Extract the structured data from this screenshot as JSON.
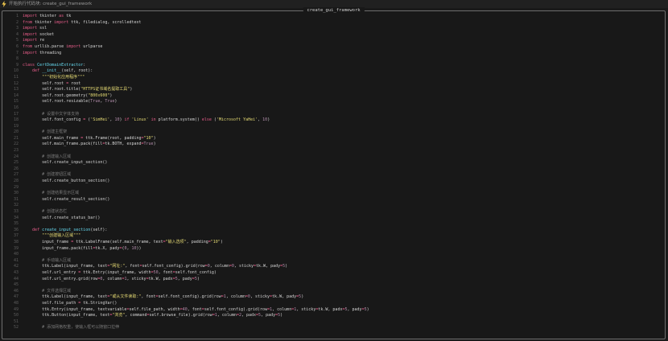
{
  "header": {
    "icon": "lightning-icon",
    "title": "开始执行代码块: create_gui_framework"
  },
  "panel": {
    "title": "create_gui_framework"
  },
  "colors": {
    "keyword": "#e85d8a",
    "string": "#e6db74",
    "comment": "#7a7a7a",
    "definition": "#66d9ef",
    "number": "#b48ead",
    "text": "#d4d4d4",
    "line_number": "#5c5c5c"
  },
  "code_lines": [
    {
      "n": "1",
      "segs": [
        [
          "k",
          "import"
        ],
        [
          "t",
          " tkinter "
        ],
        [
          "k",
          "as"
        ],
        [
          "t",
          " tk"
        ]
      ]
    },
    {
      "n": "2",
      "segs": [
        [
          "k",
          "from"
        ],
        [
          "t",
          " tkinter "
        ],
        [
          "k",
          "import"
        ],
        [
          "t",
          " ttk, filedialog, scrolledtext"
        ]
      ]
    },
    {
      "n": "3",
      "segs": [
        [
          "k",
          "import"
        ],
        [
          "t",
          " ssl"
        ]
      ]
    },
    {
      "n": "4",
      "segs": [
        [
          "k",
          "import"
        ],
        [
          "t",
          " socket"
        ]
      ]
    },
    {
      "n": "5",
      "segs": [
        [
          "k",
          "import"
        ],
        [
          "t",
          " re"
        ]
      ]
    },
    {
      "n": "6",
      "segs": [
        [
          "k",
          "from"
        ],
        [
          "t",
          " urllib.parse "
        ],
        [
          "k",
          "import"
        ],
        [
          "t",
          " urlparse"
        ]
      ]
    },
    {
      "n": "7",
      "segs": [
        [
          "k",
          "import"
        ],
        [
          "t",
          " threading"
        ]
      ]
    },
    {
      "n": "8",
      "segs": []
    },
    {
      "n": "9",
      "segs": [
        [
          "k",
          "class"
        ],
        [
          "t",
          " "
        ],
        [
          "d",
          "CertDomainExtractor"
        ],
        [
          "t",
          ":"
        ]
      ]
    },
    {
      "n": "10",
      "segs": [
        [
          "t",
          "    "
        ],
        [
          "k",
          "def"
        ],
        [
          "t",
          " "
        ],
        [
          "d",
          "__init__"
        ],
        [
          "t",
          "(self, root):"
        ]
      ]
    },
    {
      "n": "11",
      "segs": [
        [
          "t",
          "        "
        ],
        [
          "s",
          "\"\"\"初始化应用程序\"\"\""
        ]
      ]
    },
    {
      "n": "12",
      "segs": [
        [
          "t",
          "        self.root "
        ],
        [
          "k",
          "="
        ],
        [
          "t",
          " root"
        ]
      ]
    },
    {
      "n": "13",
      "segs": [
        [
          "t",
          "        self.root.title("
        ],
        [
          "s",
          "\"HTTPS证书域名提取工具\""
        ],
        [
          "t",
          ")"
        ]
      ]
    },
    {
      "n": "14",
      "segs": [
        [
          "t",
          "        self.root.geometry("
        ],
        [
          "s",
          "\"800x600\""
        ],
        [
          "t",
          ")"
        ]
      ]
    },
    {
      "n": "15",
      "segs": [
        [
          "t",
          "        self.root.resizable("
        ],
        [
          "n",
          "True"
        ],
        [
          "t",
          ", "
        ],
        [
          "n",
          "True"
        ],
        [
          "t",
          ")"
        ]
      ]
    },
    {
      "n": "16",
      "segs": []
    },
    {
      "n": "17",
      "segs": [
        [
          "t",
          "        "
        ],
        [
          "c",
          "# 设置中文字体支持"
        ]
      ]
    },
    {
      "n": "18",
      "segs": [
        [
          "t",
          "        self.font_config "
        ],
        [
          "k",
          "="
        ],
        [
          "t",
          " ("
        ],
        [
          "s",
          "'SimHei'"
        ],
        [
          "t",
          ", "
        ],
        [
          "n",
          "10"
        ],
        [
          "t",
          ") "
        ],
        [
          "k",
          "if"
        ],
        [
          "t",
          " "
        ],
        [
          "s",
          "'Linux'"
        ],
        [
          "t",
          " "
        ],
        [
          "k",
          "in"
        ],
        [
          "t",
          " platform.system() "
        ],
        [
          "k",
          "else"
        ],
        [
          "t",
          " ("
        ],
        [
          "s",
          "'Microsoft YaHei'"
        ],
        [
          "t",
          ", "
        ],
        [
          "n",
          "10"
        ],
        [
          "t",
          ")"
        ]
      ]
    },
    {
      "n": "19",
      "segs": []
    },
    {
      "n": "20",
      "segs": [
        [
          "t",
          "        "
        ],
        [
          "c",
          "# 创建主框架"
        ]
      ]
    },
    {
      "n": "21",
      "segs": [
        [
          "t",
          "        self.main_frame "
        ],
        [
          "k",
          "="
        ],
        [
          "t",
          " ttk.Frame(root, padding"
        ],
        [
          "k",
          "="
        ],
        [
          "s",
          "\"10\""
        ],
        [
          "t",
          ")"
        ]
      ]
    },
    {
      "n": "22",
      "segs": [
        [
          "t",
          "        self.main_frame.pack(fill"
        ],
        [
          "k",
          "="
        ],
        [
          "t",
          "tk.BOTH, expand"
        ],
        [
          "k",
          "="
        ],
        [
          "n",
          "True"
        ],
        [
          "t",
          ")"
        ]
      ]
    },
    {
      "n": "23",
      "segs": []
    },
    {
      "n": "24",
      "segs": [
        [
          "t",
          "        "
        ],
        [
          "c",
          "# 创建输入区域"
        ]
      ]
    },
    {
      "n": "25",
      "segs": [
        [
          "t",
          "        self.create_input_section()"
        ]
      ]
    },
    {
      "n": "26",
      "segs": []
    },
    {
      "n": "27",
      "segs": [
        [
          "t",
          "        "
        ],
        [
          "c",
          "# 创建按钮区域"
        ]
      ]
    },
    {
      "n": "28",
      "segs": [
        [
          "t",
          "        self.create_button_section()"
        ]
      ]
    },
    {
      "n": "29",
      "segs": []
    },
    {
      "n": "30",
      "segs": [
        [
          "t",
          "        "
        ],
        [
          "c",
          "# 创建结果显示区域"
        ]
      ]
    },
    {
      "n": "31",
      "segs": [
        [
          "t",
          "        self.create_result_section()"
        ]
      ]
    },
    {
      "n": "32",
      "segs": []
    },
    {
      "n": "33",
      "segs": [
        [
          "t",
          "        "
        ],
        [
          "c",
          "# 创建状态栏"
        ]
      ]
    },
    {
      "n": "34",
      "segs": [
        [
          "t",
          "        self.create_status_bar()"
        ]
      ]
    },
    {
      "n": "35",
      "segs": []
    },
    {
      "n": "36",
      "segs": [
        [
          "t",
          "    "
        ],
        [
          "k",
          "def"
        ],
        [
          "t",
          " "
        ],
        [
          "d",
          "create_input_section"
        ],
        [
          "t",
          "(self):"
        ]
      ]
    },
    {
      "n": "37",
      "segs": [
        [
          "t",
          "        "
        ],
        [
          "s",
          "\"\"\"创建输入区域\"\"\""
        ]
      ]
    },
    {
      "n": "38",
      "segs": [
        [
          "t",
          "        input_frame "
        ],
        [
          "k",
          "="
        ],
        [
          "t",
          " ttk.LabelFrame(self.main_frame, text"
        ],
        [
          "k",
          "="
        ],
        [
          "s",
          "\"输入选项\""
        ],
        [
          "t",
          ", padding"
        ],
        [
          "k",
          "="
        ],
        [
          "s",
          "\"10\""
        ],
        [
          "t",
          ")"
        ]
      ]
    },
    {
      "n": "39",
      "segs": [
        [
          "t",
          "        input_frame.pack(fill"
        ],
        [
          "k",
          "="
        ],
        [
          "t",
          "tk.X, pady"
        ],
        [
          "k",
          "="
        ],
        [
          "t",
          "("
        ],
        [
          "n",
          "0"
        ],
        [
          "t",
          ", "
        ],
        [
          "n",
          "10"
        ],
        [
          "t",
          "))"
        ]
      ]
    },
    {
      "n": "40",
      "segs": []
    },
    {
      "n": "41",
      "segs": [
        [
          "t",
          "        "
        ],
        [
          "c",
          "# 手动输入区域"
        ]
      ]
    },
    {
      "n": "42",
      "segs": [
        [
          "t",
          "        ttk.Label(input_frame, text"
        ],
        [
          "k",
          "="
        ],
        [
          "s",
          "\"网址:\""
        ],
        [
          "t",
          ", font"
        ],
        [
          "k",
          "="
        ],
        [
          "t",
          "self.font_config).grid(row"
        ],
        [
          "k",
          "="
        ],
        [
          "n",
          "0"
        ],
        [
          "t",
          ", column"
        ],
        [
          "k",
          "="
        ],
        [
          "n",
          "0"
        ],
        [
          "t",
          ", sticky"
        ],
        [
          "k",
          "="
        ],
        [
          "t",
          "tk.W, pady"
        ],
        [
          "k",
          "="
        ],
        [
          "n",
          "5"
        ],
        [
          "t",
          ")"
        ]
      ]
    },
    {
      "n": "43",
      "segs": [
        [
          "t",
          "        self.url_entry "
        ],
        [
          "k",
          "="
        ],
        [
          "t",
          " ttk.Entry(input_frame, width"
        ],
        [
          "k",
          "="
        ],
        [
          "n",
          "50"
        ],
        [
          "t",
          ", font"
        ],
        [
          "k",
          "="
        ],
        [
          "t",
          "self.font_config)"
        ]
      ]
    },
    {
      "n": "44",
      "segs": [
        [
          "t",
          "        self.url_entry.grid(row"
        ],
        [
          "k",
          "="
        ],
        [
          "n",
          "0"
        ],
        [
          "t",
          ", column"
        ],
        [
          "k",
          "="
        ],
        [
          "n",
          "1"
        ],
        [
          "t",
          ", sticky"
        ],
        [
          "k",
          "="
        ],
        [
          "t",
          "tk.W, padx"
        ],
        [
          "k",
          "="
        ],
        [
          "n",
          "5"
        ],
        [
          "t",
          ", pady"
        ],
        [
          "k",
          "="
        ],
        [
          "n",
          "5"
        ],
        [
          "t",
          ")"
        ]
      ]
    },
    {
      "n": "45",
      "segs": []
    },
    {
      "n": "46",
      "segs": [
        [
          "t",
          "        "
        ],
        [
          "c",
          "# 文件选择区域"
        ]
      ]
    },
    {
      "n": "47",
      "segs": [
        [
          "t",
          "        ttk.Label(input_frame, text"
        ],
        [
          "k",
          "="
        ],
        [
          "s",
          "\"或从文件读取:\""
        ],
        [
          "t",
          ", font"
        ],
        [
          "k",
          "="
        ],
        [
          "t",
          "self.font_config).grid(row"
        ],
        [
          "k",
          "="
        ],
        [
          "n",
          "1"
        ],
        [
          "t",
          ", column"
        ],
        [
          "k",
          "="
        ],
        [
          "n",
          "0"
        ],
        [
          "t",
          ", sticky"
        ],
        [
          "k",
          "="
        ],
        [
          "t",
          "tk.W, pady"
        ],
        [
          "k",
          "="
        ],
        [
          "n",
          "5"
        ],
        [
          "t",
          ")"
        ]
      ]
    },
    {
      "n": "48",
      "segs": [
        [
          "t",
          "        self.file_path "
        ],
        [
          "k",
          "="
        ],
        [
          "t",
          " tk.StringVar()"
        ]
      ]
    },
    {
      "n": "49",
      "segs": [
        [
          "t",
          "        ttk.Entry(input_frame, textvariable"
        ],
        [
          "k",
          "="
        ],
        [
          "t",
          "self.file_path, width"
        ],
        [
          "k",
          "="
        ],
        [
          "n",
          "40"
        ],
        [
          "t",
          ", font"
        ],
        [
          "k",
          "="
        ],
        [
          "t",
          "self.font_config).grid(row"
        ],
        [
          "k",
          "="
        ],
        [
          "n",
          "1"
        ],
        [
          "t",
          ", column"
        ],
        [
          "k",
          "="
        ],
        [
          "n",
          "1"
        ],
        [
          "t",
          ", sticky"
        ],
        [
          "k",
          "="
        ],
        [
          "t",
          "tk.W, padx"
        ],
        [
          "k",
          "="
        ],
        [
          "n",
          "5"
        ],
        [
          "t",
          ", pady"
        ],
        [
          "k",
          "="
        ],
        [
          "n",
          "5"
        ],
        [
          "t",
          ")"
        ]
      ]
    },
    {
      "n": "50",
      "segs": [
        [
          "t",
          "        ttk.Button(input_frame, text"
        ],
        [
          "k",
          "="
        ],
        [
          "s",
          "\"浏览\""
        ],
        [
          "t",
          ", command"
        ],
        [
          "k",
          "="
        ],
        [
          "t",
          "self.browse_file).grid(row"
        ],
        [
          "k",
          "="
        ],
        [
          "n",
          "1"
        ],
        [
          "t",
          ", column"
        ],
        [
          "k",
          "="
        ],
        [
          "n",
          "2"
        ],
        [
          "t",
          ", padx"
        ],
        [
          "k",
          "="
        ],
        [
          "n",
          "5"
        ],
        [
          "t",
          ", pady"
        ],
        [
          "k",
          "="
        ],
        [
          "n",
          "5"
        ],
        [
          "t",
          ")"
        ]
      ]
    },
    {
      "n": "51",
      "segs": []
    },
    {
      "n": "52",
      "segs": [
        [
          "t",
          "        "
        ],
        [
          "c",
          "# 添加网格权重，使输入框可以随窗口拉伸"
        ]
      ]
    }
  ]
}
